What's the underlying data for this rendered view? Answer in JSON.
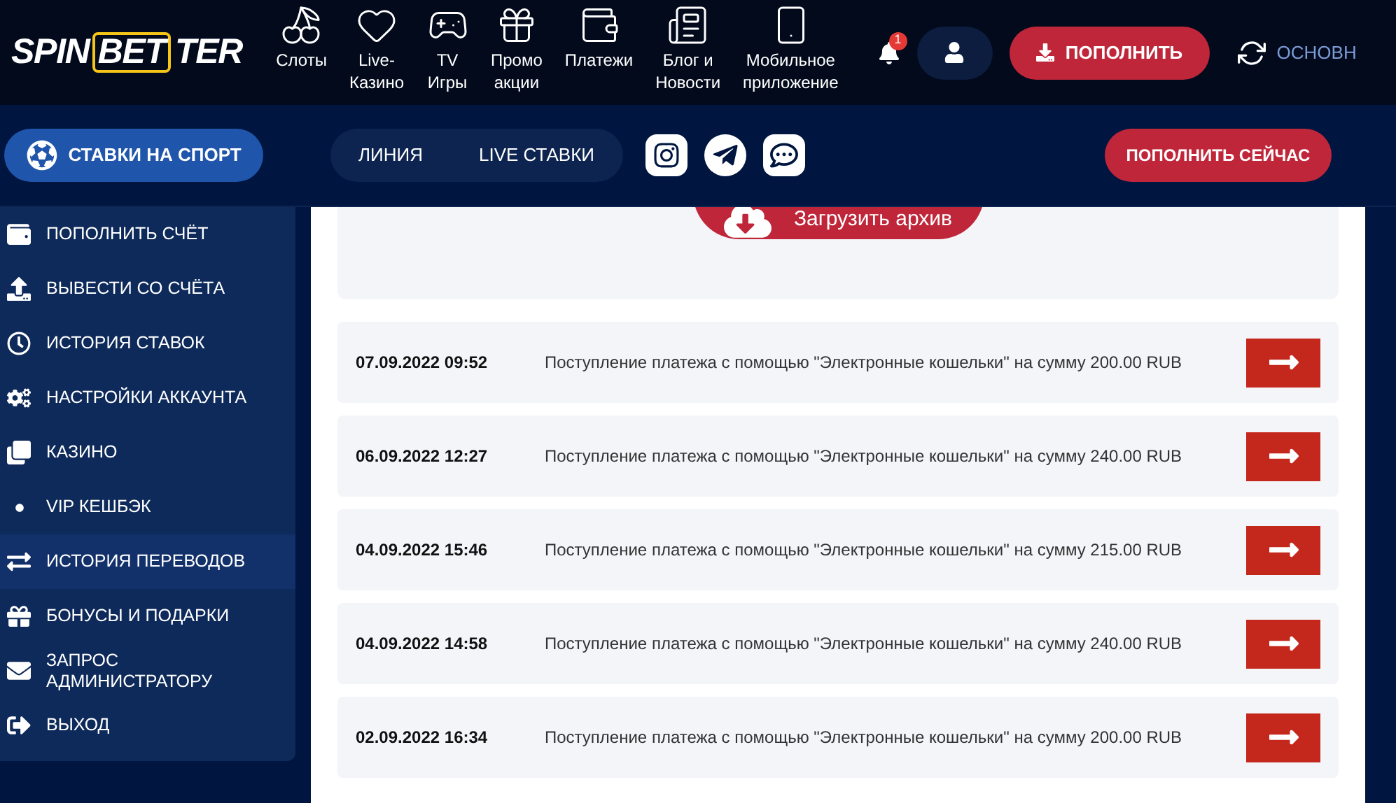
{
  "header": {
    "logo": {
      "left": "SPIN",
      "boxed": "BET",
      "right": "TER"
    },
    "nav": [
      {
        "kind": "slots",
        "label": "Слоты"
      },
      {
        "kind": "casino",
        "label": "Live-\nКазино"
      },
      {
        "kind": "tv",
        "label": "TV\nИгры"
      },
      {
        "kind": "promo",
        "label": "Промо\nакции"
      },
      {
        "kind": "payments",
        "label": "Платежи"
      },
      {
        "kind": "blog",
        "label": "Блог и\nНовости"
      },
      {
        "kind": "mobile",
        "label": "Мобильное\nприложение"
      }
    ],
    "notifications": {
      "count": "1"
    },
    "deposit_button": "ПОПОЛНИТЬ",
    "balance_label": "ОСНОВН"
  },
  "subbar": {
    "sports_button": "СТАВКИ НА СПОРТ",
    "tabs": [
      {
        "label": "ЛИНИЯ",
        "selected": false
      },
      {
        "label": "LIVE СТАВКИ",
        "selected": false
      }
    ],
    "socials": [
      {
        "kind": "instagram"
      },
      {
        "kind": "telegram"
      },
      {
        "kind": "chat"
      }
    ],
    "deposit_now_button": "ПОПОЛНИТЬ СЕЙЧАС"
  },
  "sidebar": {
    "items": [
      {
        "kind": "deposit",
        "label": "ПОПОЛНИТЬ СЧЁТ",
        "selected": false
      },
      {
        "kind": "withdraw",
        "label": "ВЫВЕСТИ СО СЧЁТА",
        "selected": false
      },
      {
        "kind": "history",
        "label": "ИСТОРИЯ СТАВОК",
        "selected": false
      },
      {
        "kind": "settings",
        "label": "НАСТРОЙКИ АККАУНТА",
        "selected": false
      },
      {
        "kind": "casino",
        "label": "КАЗИНО",
        "selected": false
      },
      {
        "kind": "dot",
        "label": "VIP КЕШБЭК",
        "selected": false
      },
      {
        "kind": "transfers",
        "label": "ИСТОРИЯ ПЕРЕВОДОВ",
        "selected": true
      },
      {
        "kind": "bonus",
        "label": "БОНУСЫ И ПОДАРКИ",
        "selected": false
      },
      {
        "kind": "mail",
        "label": "ЗАПРОС АДМИНИСТРАТОРУ",
        "selected": false
      },
      {
        "kind": "logout",
        "label": "ВЫХОД",
        "selected": false
      }
    ]
  },
  "archive_button": "Загрузить архив",
  "transactions": [
    {
      "date": "07.09.2022 09:52",
      "description": "Поступление платежа с помощью \"Электронные кошельки\" на сумму 200.00 RUB"
    },
    {
      "date": "06.09.2022 12:27",
      "description": "Поступление платежа с помощью \"Электронные кошельки\" на сумму 240.00 RUB"
    },
    {
      "date": "04.09.2022 15:46",
      "description": "Поступление платежа с помощью \"Электронные кошельки\" на сумму 215.00 RUB"
    },
    {
      "date": "04.09.2022 14:58",
      "description": "Поступление платежа с помощью \"Электронные кошельки\" на сумму 240.00 RUB"
    },
    {
      "date": "02.09.2022 16:34",
      "description": "Поступление платежа с помощью \"Электронные кошельки\" на сумму 200.00 RUB"
    }
  ]
}
